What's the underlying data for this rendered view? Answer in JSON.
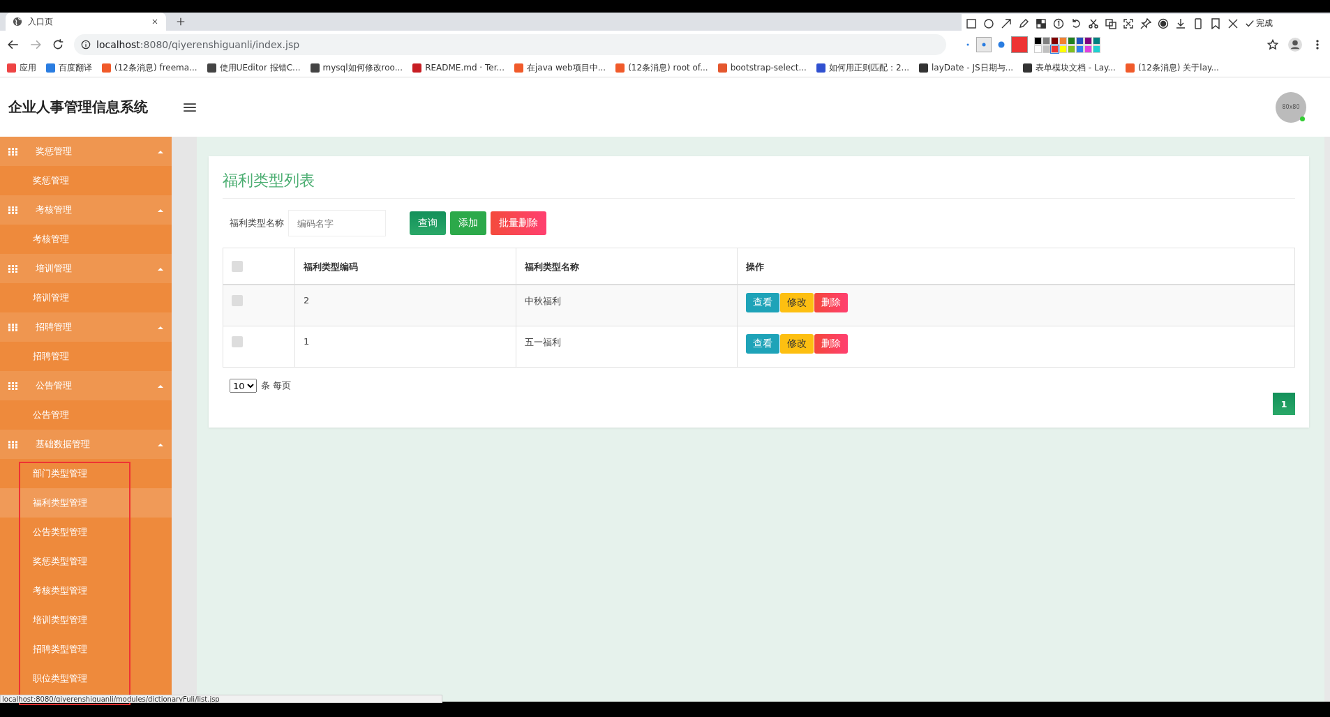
{
  "browser": {
    "tab_title": "入口页",
    "url_host": "localhost",
    "url_rest": ":8080/qiyerenshiguanli/index.jsp",
    "bookmarks": [
      {
        "label": "应用",
        "kind": "apps"
      },
      {
        "label": "百度翻译",
        "kind": "translate"
      },
      {
        "label": "(12条消息) freema...",
        "kind": "csdn"
      },
      {
        "label": "使用UEditor 报错C...",
        "kind": "yuque"
      },
      {
        "label": "mysql如何修改roo...",
        "kind": "yuque"
      },
      {
        "label": "README.md · Ter...",
        "kind": "gitee"
      },
      {
        "label": "在java web项目中...",
        "kind": "csdn"
      },
      {
        "label": "(12条消息) root of...",
        "kind": "csdn"
      },
      {
        "label": "bootstrap-select...",
        "kind": "jian"
      },
      {
        "label": "如何用正则匹配：2...",
        "kind": "paw"
      },
      {
        "label": "layDate - JS日期与...",
        "kind": "lay"
      },
      {
        "label": "表单模块文档 - Lay...",
        "kind": "lay"
      },
      {
        "label": "(12条消息) 关于lay...",
        "kind": "csdn"
      }
    ]
  },
  "snip_toolbar": {
    "done": "完成",
    "palette": [
      {
        "color": "#000000"
      },
      {
        "color": "#808080"
      },
      {
        "color": "#800000"
      },
      {
        "color": "#f08030"
      },
      {
        "color": "#208020"
      },
      {
        "color": "#2050c0"
      },
      {
        "color": "#800080"
      },
      {
        "color": "#008080"
      },
      {
        "color": "#ffffff"
      },
      {
        "color": "#c0c0c0"
      },
      {
        "color": "#ee3333",
        "selected": true
      },
      {
        "color": "#ffff00"
      },
      {
        "color": "#80c020"
      },
      {
        "color": "#3080f0"
      },
      {
        "color": "#e040e0"
      },
      {
        "color": "#20d0d0"
      }
    ]
  },
  "app": {
    "title": "企业人事管理信息系统",
    "avatar": "80x80"
  },
  "sidebar": [
    {
      "label": "奖惩管理",
      "expanded": true,
      "children": [
        {
          "label": "奖惩管理",
          "selected": false
        }
      ]
    },
    {
      "label": "考核管理",
      "expanded": true,
      "children": [
        {
          "label": "考核管理",
          "selected": false
        }
      ]
    },
    {
      "label": "培训管理",
      "expanded": true,
      "children": [
        {
          "label": "培训管理",
          "selected": false
        }
      ]
    },
    {
      "label": "招聘管理",
      "expanded": true,
      "children": [
        {
          "label": "招聘管理",
          "selected": false
        }
      ]
    },
    {
      "label": "公告管理",
      "expanded": true,
      "children": [
        {
          "label": "公告管理",
          "selected": false
        }
      ]
    },
    {
      "label": "基础数据管理",
      "expanded": true,
      "children": [
        {
          "label": "部门类型管理",
          "selected": false
        },
        {
          "label": "福利类型管理",
          "selected": true
        },
        {
          "label": "公告类型管理",
          "selected": false
        },
        {
          "label": "奖惩类型管理",
          "selected": false
        },
        {
          "label": "考核类型管理",
          "selected": false
        },
        {
          "label": "培训类型管理",
          "selected": false
        },
        {
          "label": "招聘类型管理",
          "selected": false
        },
        {
          "label": "职位类型管理",
          "selected": false
        }
      ]
    }
  ],
  "card": {
    "title": "福利类型列表",
    "search_label": "福利类型名称",
    "search": {
      "placeholder": "编码名字"
    },
    "buttons": [
      {
        "label": "查询",
        "kind": "search"
      },
      {
        "label": "添加",
        "kind": "add"
      },
      {
        "label": "批量删除",
        "kind": "delete"
      }
    ],
    "table": {
      "select_all_checked": false,
      "columns": [
        "福利类型编码",
        "福利类型名称",
        "操作"
      ],
      "rows": [
        {
          "checked": false,
          "code": "2",
          "name": "中秋福利",
          "actions": [
            {
              "label": "查看",
              "kind": "view"
            },
            {
              "label": "修改",
              "kind": "edit"
            },
            {
              "label": "删除",
              "kind": "delete"
            }
          ]
        },
        {
          "checked": false,
          "code": "1",
          "name": "五一福利",
          "actions": [
            {
              "label": "查看",
              "kind": "view"
            },
            {
              "label": "修改",
              "kind": "edit"
            },
            {
              "label": "删除",
              "kind": "delete"
            }
          ]
        }
      ]
    },
    "page_size": "10",
    "per_page": "条 每页",
    "pages": [
      {
        "label": "1",
        "selected": true
      }
    ]
  },
  "status_url": "localhost:8080/qiyerenshiguanli/modules/dictionaryFuli/list.jsp"
}
